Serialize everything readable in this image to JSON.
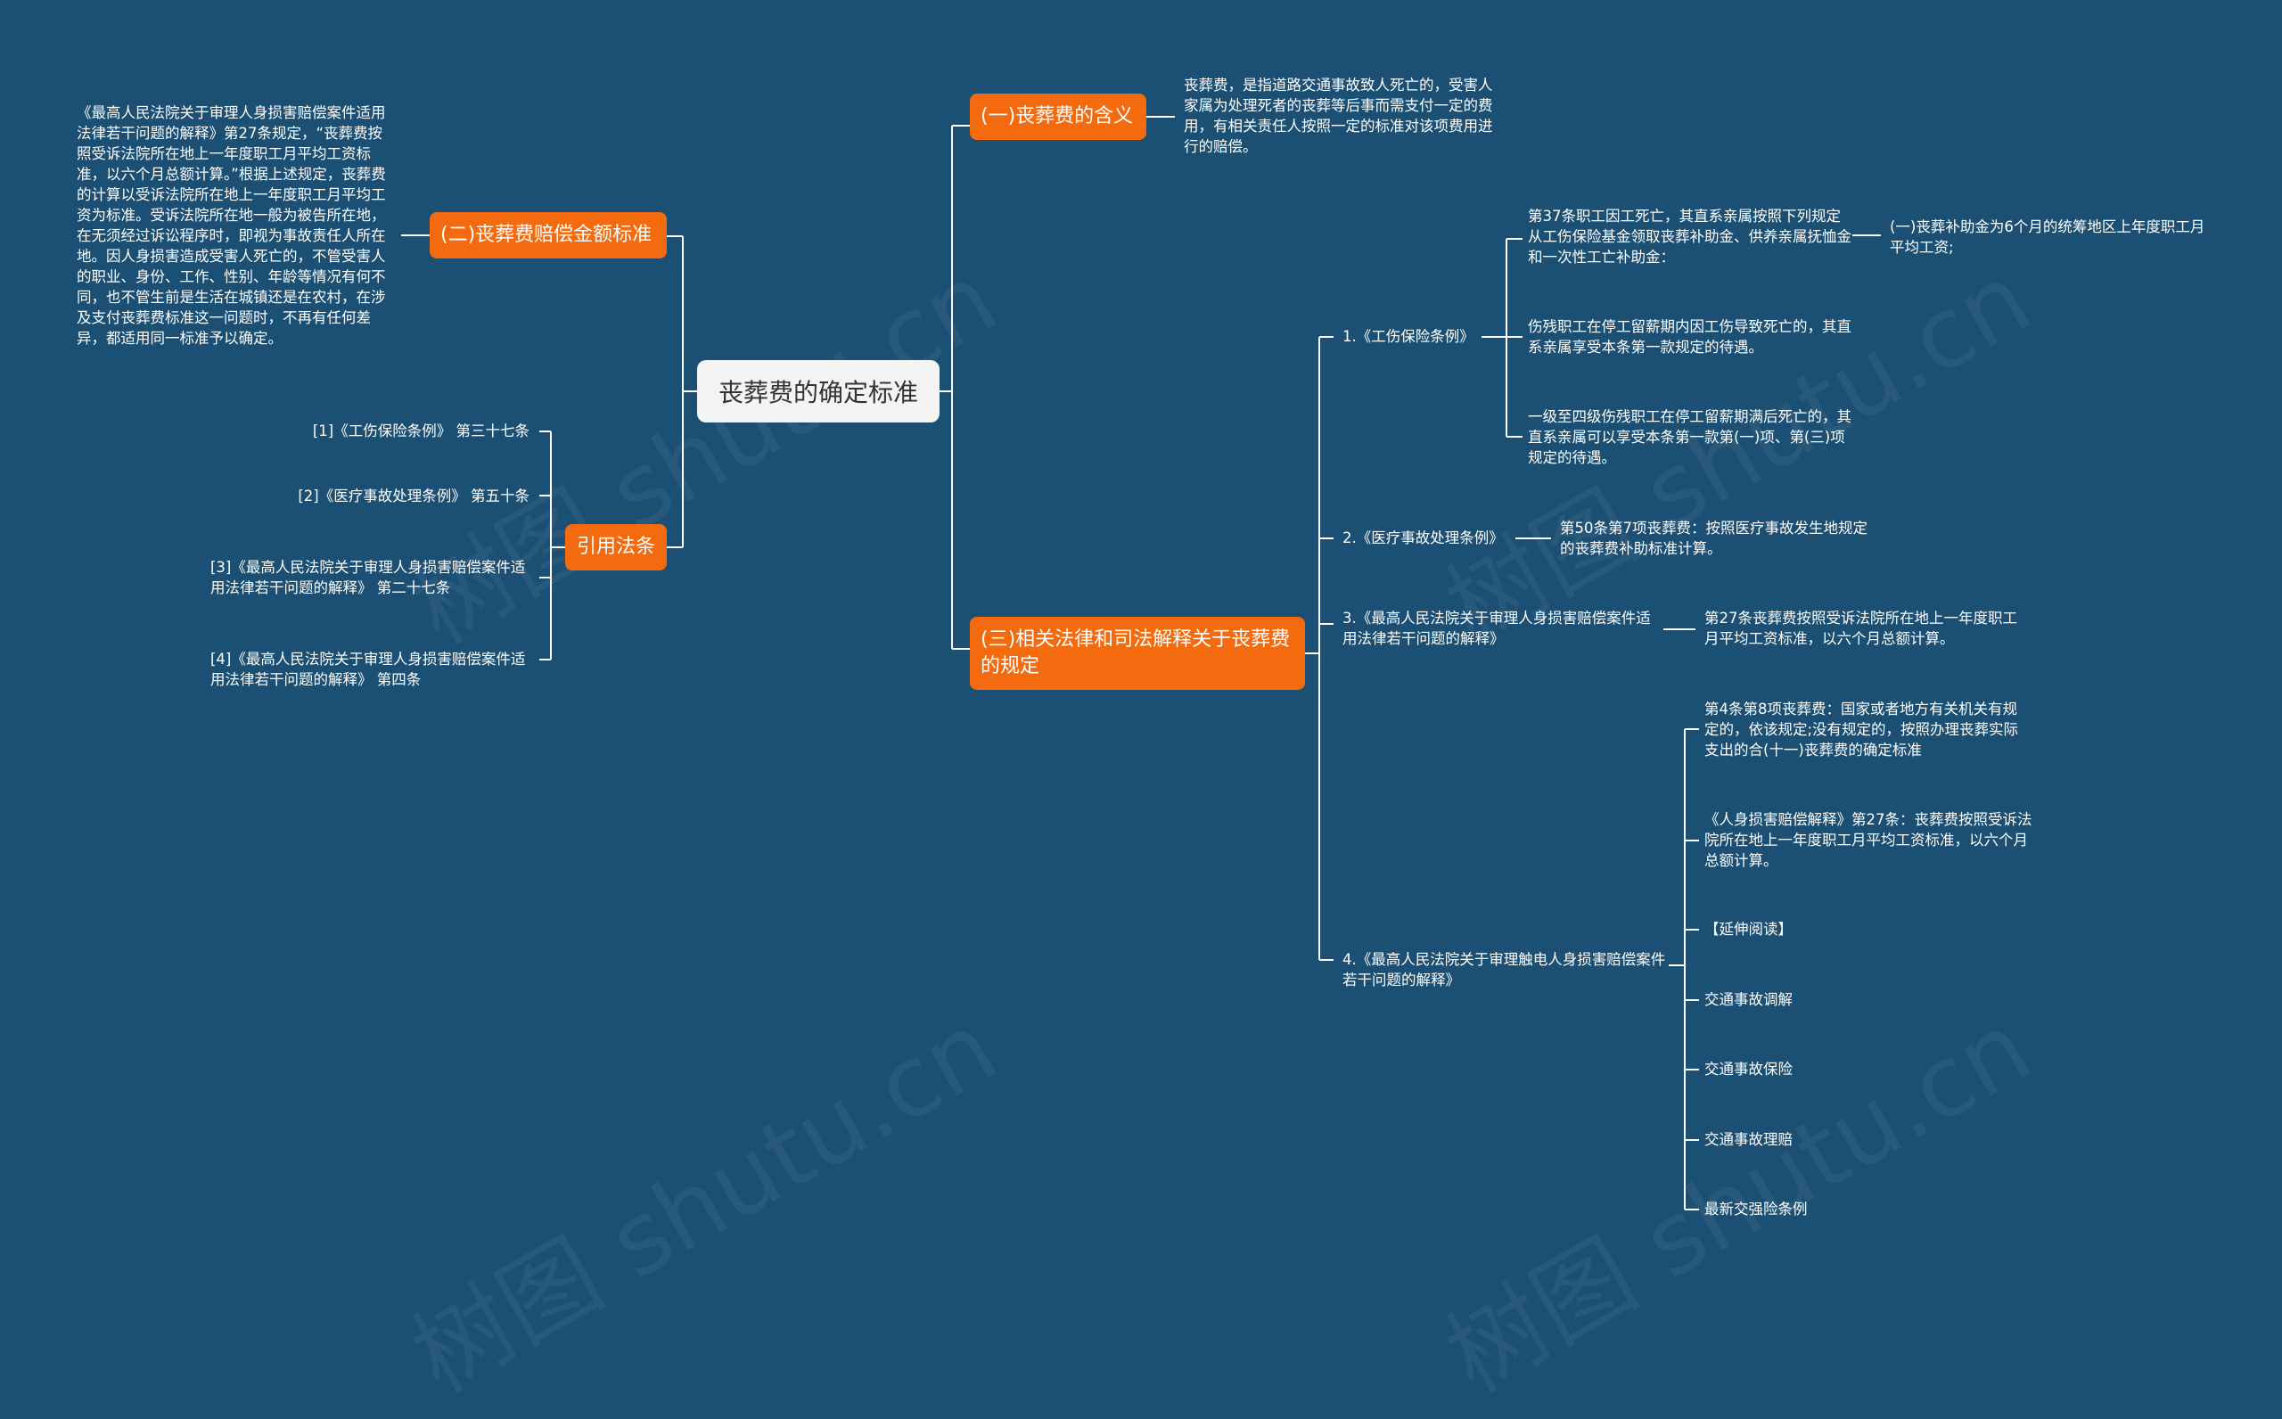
{
  "root": "丧葬费的确定标准",
  "topics": {
    "meaning": "(一)丧葬费的含义",
    "standard": "(二)丧葬费赔偿金额标准",
    "laws": "(三)相关法律和司法解释关于丧葬费的规定",
    "cited": "引用法条"
  },
  "meaning_detail": "丧葬费，是指道路交通事故致人死亡的，受害人家属为处理死者的丧葬等后事而需支付一定的费用，有相关责任人按照一定的标准对该项费用进行的赔偿。",
  "standard_detail": "《最高人民法院关于审理人身损害赔偿案件适用法律若干问题的解释》第27条规定，“丧葬费按照受诉法院所在地上一年度职工月平均工资标准，以六个月总额计算。”根据上述规定，丧葬费的计算以受诉法院所在地上一年度职工月平均工资为标准。受诉法院所在地一般为被告所在地，在无须经过诉讼程序时，即视为事故责任人所在地。因人身损害造成受害人死亡的，不管受害人的职业、身份、工作、性别、年龄等情况有何不同，也不管生前是生活在城镇还是在农村，在涉及支付丧葬费标准这一问题时，不再有任何差异，都适用同一标准予以确定。",
  "cited_items": [
    "[1]《工伤保险条例》 第三十七条",
    "[2]《医疗事故处理条例》 第五十条",
    "[3]《最高人民法院关于审理人身损害赔偿案件适用法律若干问题的解释》 第二十七条",
    "[4]《最高人民法院关于审理人身损害赔偿案件适用法律若干问题的解释》 第四条"
  ],
  "law_items": [
    "1.《工伤保险条例》",
    "2.《医疗事故处理条例》",
    "3.《最高人民法院关于审理人身损害赔偿案件适用法律若干问题的解释》",
    "4.《最高人民法院关于审理触电人身损害赔偿案件若干问题的解释》"
  ],
  "law1_details": [
    "第37条职工因工死亡，其直系亲属按照下列规定从工伤保险基金领取丧葬补助金、供养亲属抚恤金和一次性工亡补助金：",
    "伤残职工在停工留薪期内因工伤导致死亡的，其直系亲属享受本条第一款规定的待遇。",
    "一级至四级伤残职工在停工留薪期满后死亡的，其直系亲属可以享受本条第一款第(一)项、第(三)项规定的待遇。"
  ],
  "law1_sub": "(一)丧葬补助金为6个月的统筹地区上年度职工月平均工资;",
  "law2_detail": "第50条第7项丧葬费：按照医疗事故发生地规定的丧葬费补助标准计算。",
  "law3_detail": "第27条丧葬费按照受诉法院所在地上一年度职工月平均工资标准，以六个月总额计算。",
  "law4_details": [
    "第4条第8项丧葬费：国家或者地方有关机关有规定的，依该规定;没有规定的，按照办理丧葬实际支出的合(十一)丧葬费的确定标准",
    "《人身损害赔偿解释》第27条：丧葬费按照受诉法院所在地上一年度职工月平均工资标准，以六个月总额计算。",
    "【延伸阅读】",
    "交通事故调解",
    "交通事故保险",
    "交通事故理赔",
    "最新交强险条例"
  ],
  "watermark": "树图 shutu.cn",
  "colors": {
    "background": "#1b4f73",
    "accent": "#f46a0e",
    "line": "#ffffff"
  }
}
